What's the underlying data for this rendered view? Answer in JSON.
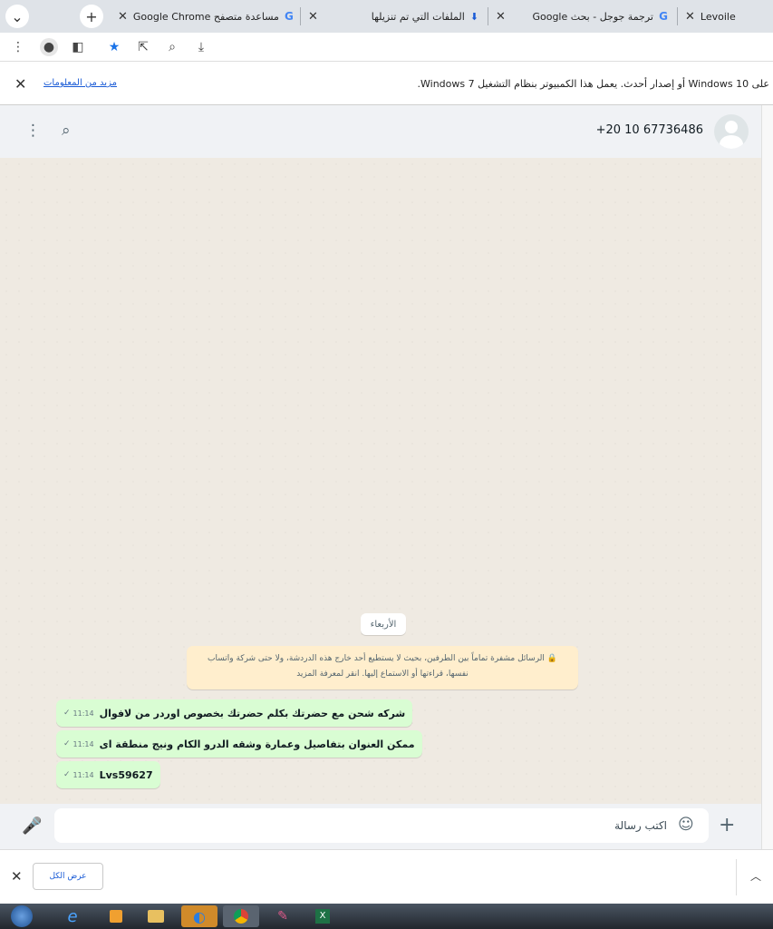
{
  "tabs": [
    {
      "title": "Levoile",
      "icon": "levoile-favicon"
    },
    {
      "title": "ترجمة جوجل - بحث Google",
      "icon": "google-icon"
    },
    {
      "title": "الملفات التي تم تنزيلها",
      "icon": "download-icon"
    },
    {
      "title": "مساعدة متصفح Google Chrome",
      "icon": "google-icon"
    }
  ],
  "infobar": {
    "message": "على Windows 10 أو إصدار أحدث. يعمل هذا الكمبيوتر بنظام التشغيل Windows 7.",
    "more_link": "مزيد من المعلومات"
  },
  "whatsapp": {
    "contact_phone": "+20 10 67736486",
    "day_label": "الأربعاء",
    "encryption_notice": "الرسائل مشفرة تماماً بين الطرفين، بحيث لا يستطيع أحد خارج هذه الدردشة، ولا حتى شركة واتساب نفسها، قراءتها أو الاستماع إليها. انقر لمعرفة المزيد",
    "messages": [
      {
        "text": "شركه شحن مع حضرتك بكلم حضرتك بخصوص اوردر من لافوال",
        "time": "11:14"
      },
      {
        "text": "ممكن العنوان بتفاصيل وعمارة وشقه الدرو الكام ونيج منطقة اى",
        "time": "11:14"
      },
      {
        "text": "Lvs59627",
        "time": "11:14"
      }
    ],
    "composer_placeholder": "اكتب رسالة"
  },
  "download_bar": {
    "show_all": "عرض الكل"
  }
}
